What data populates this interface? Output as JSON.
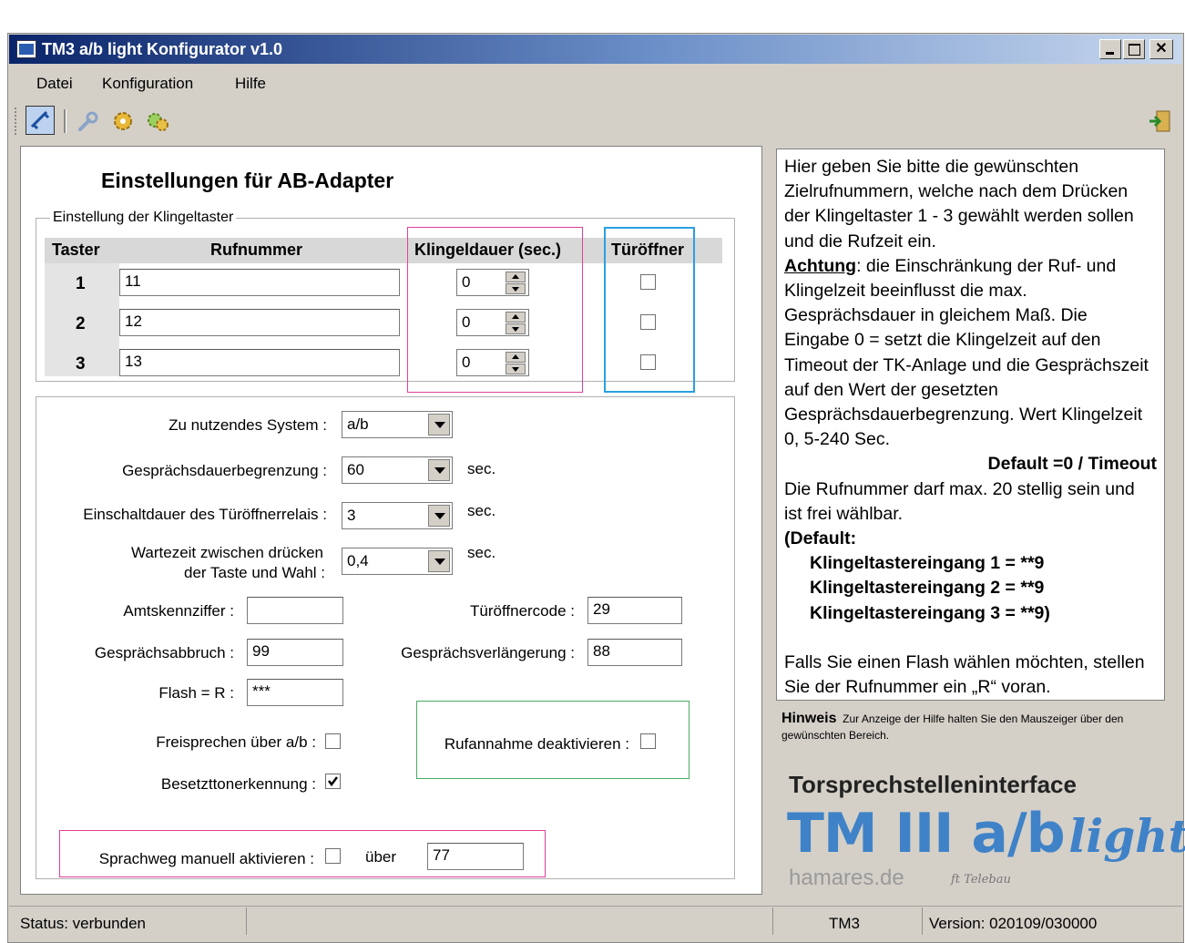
{
  "window": {
    "title": "TM3 a/b light Konfigurator v1.0"
  },
  "menu": {
    "items": [
      "Datei",
      "Konfiguration",
      "Hilfe"
    ]
  },
  "toolbar": {
    "icons": [
      "connect-icon",
      "wrench-icon",
      "gear-icon",
      "gears-icon",
      "exit-icon"
    ]
  },
  "form": {
    "title": "Einstellungen für AB-Adapter",
    "group_label": "Einstellung der Klingeltaster",
    "headers": {
      "taster": "Taster",
      "rufnummer": "Rufnummer",
      "klingeldauer": "Klingeldauer (sec.)",
      "tueroeffner": "Türöffner"
    },
    "rows": [
      {
        "taster": "1",
        "rufnummer": "11",
        "klingeldauer": "0",
        "tueroeffner": false
      },
      {
        "taster": "2",
        "rufnummer": "12",
        "klingeldauer": "0",
        "tueroeffner": false
      },
      {
        "taster": "3",
        "rufnummer": "13",
        "klingeldauer": "0",
        "tueroeffner": false
      }
    ],
    "system_label": "Zu nutzendes System :",
    "system_value": "a/b",
    "dauer_label": "Gesprächsdauerbegrenzung :",
    "dauer_value": "60",
    "einschalt_label": "Einschaltdauer des Türöffnerrelais :",
    "einschalt_value": "3",
    "warte_label_1": "Wartezeit zwischen drücken",
    "warte_label_2": "der Taste und Wahl :",
    "warte_value": "0,4",
    "unit_sec": "sec.",
    "amt_label": "Amtskennziffer :",
    "amt_value": "",
    "tuer_code_label": "Türöffnercode :",
    "tuer_code_value": "29",
    "abbruch_label": "Gesprächsabbruch :",
    "abbruch_value": "99",
    "verl_label": "Gesprächsverlängerung :",
    "verl_value": "88",
    "flash_label": "Flash = R :",
    "flash_value": "***",
    "frei_label": "Freisprechen über a/b :",
    "frei_checked": false,
    "rufannahme_label": "Rufannahme deaktivieren :",
    "rufannahme_checked": false,
    "besetzt_label": "Besetzttonerkennung :",
    "besetzt_checked": true,
    "sprach_label": "Sprachweg manuell aktivieren :",
    "sprach_checked": false,
    "ueber_label": "über",
    "ueber_value": "77"
  },
  "help": {
    "p1": "Hier geben Sie bitte die gewünschten Zielrufnummern, welche nach dem Drücken der Klingeltaster 1 - 3 gewählt werden sollen und die Rufzeit ein.",
    "achtung": "Achtung",
    "p2": ": die Einschränkung der Ruf- und Klingelzeit beeinflusst die max. Gesprächsdauer in gleichem Maß. Die Eingabe 0 = setzt die Klingelzeit auf den Timeout der TK-Anlage und die Gesprächszeit auf den Wert der gesetzten Gesprächsdauerbegrenzung. Wert Klingelzeit 0, 5-240 Sec.",
    "default_line": "Default =0 / Timeout",
    "p3": "Die Rufnummer darf max. 20 stellig sein und ist frei wählbar.",
    "default_head": "(Default:",
    "d1": "Klingeltastereingang 1 = **9",
    "d2": "Klingeltastereingang 2 = **9",
    "d3": "Klingeltastereingang 3 = **9)",
    "p4": "Falls Sie einen Flash wählen möchten, stellen Sie der Rufnummer ein „R“ voran."
  },
  "hint": {
    "title": "Hinweis",
    "text": "Zur Anzeige der Hilfe halten Sie den Mauszeiger über den gewünschten Bereich."
  },
  "brand": {
    "heading": "Torsprechstelleninterface",
    "logo_main": "TM III a/b",
    "logo_script": "light",
    "site": "hamares.de",
    "partner": "ft Telebau"
  },
  "status": {
    "left": "Status: verbunden",
    "device": "TM3",
    "version": "Version: 020109/030000"
  },
  "colors": {
    "frame": "#d4d0c8",
    "title_start": "#0a246a",
    "title_end": "#a6caf0",
    "pink": "#e0409a",
    "blue": "#2aa0e0",
    "green": "#4aaa66",
    "logo_blue": "#3f82c8",
    "logo_gray": "#9a9a9a"
  }
}
